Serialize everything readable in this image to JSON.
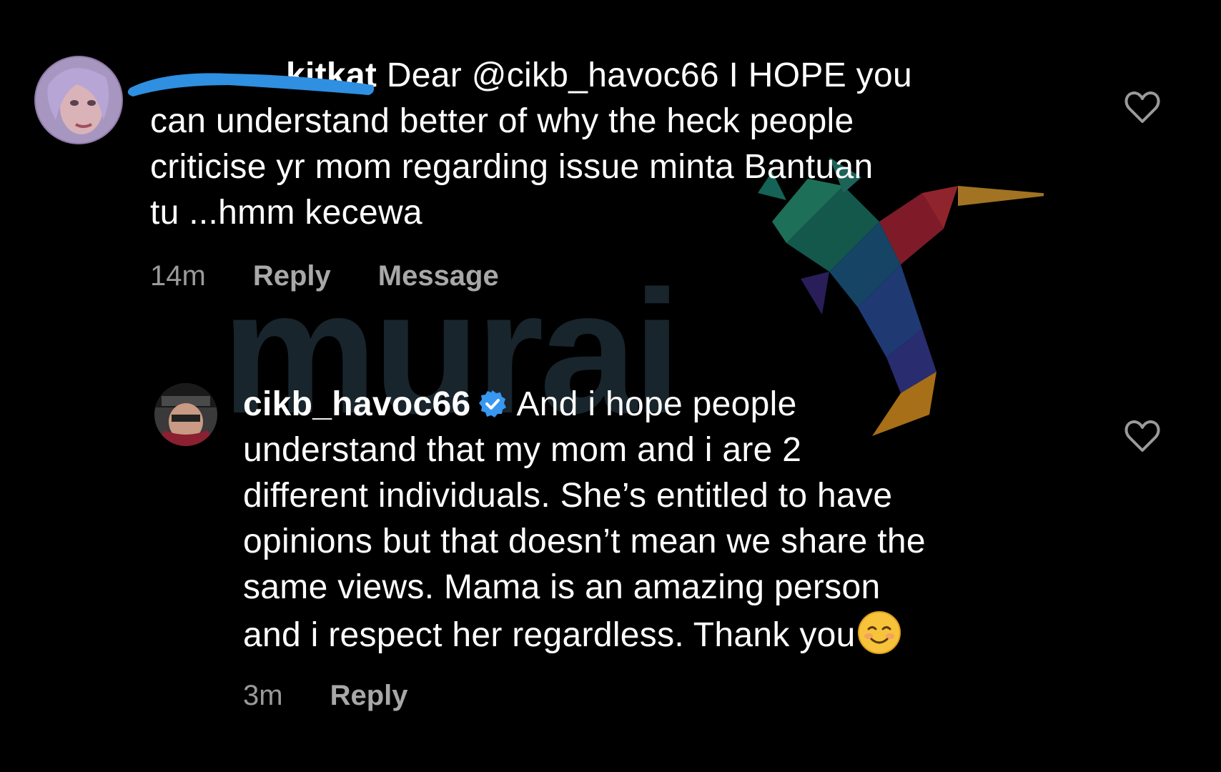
{
  "watermark": {
    "text": "murai"
  },
  "comment1": {
    "username": "kitkat",
    "text_line1": "Dear @cikb_havoc66 I HOPE you",
    "text_line2": "can understand better of why the heck people",
    "text_line3": "criticise yr mom regarding issue minta Bantuan",
    "text_line4": "tu ...hmm kecewa",
    "time": "14m",
    "reply_label": "Reply",
    "message_label": "Message"
  },
  "comment2": {
    "username": "cikb_havoc66",
    "text_line1": "And i hope people",
    "text_line2": "understand that my mom and i are 2",
    "text_line3": "different individuals. She’s entitled to have",
    "text_line4": "opinions but that doesn’t mean we share the",
    "text_line5": "same views. Mama is an amazing person",
    "text_line6": "and i respect her regardless. Thank you",
    "time": "3m",
    "reply_label": "Reply"
  },
  "icons": {
    "like": "heart-outline-icon",
    "verified": "verified-badge-icon",
    "emoji": "smiling-face-emoji"
  },
  "colors": {
    "background": "#000000",
    "text": "#ffffff",
    "meta": "#9a9a9a",
    "verified": "#3897f0",
    "redaction": "#2f8fe0"
  }
}
